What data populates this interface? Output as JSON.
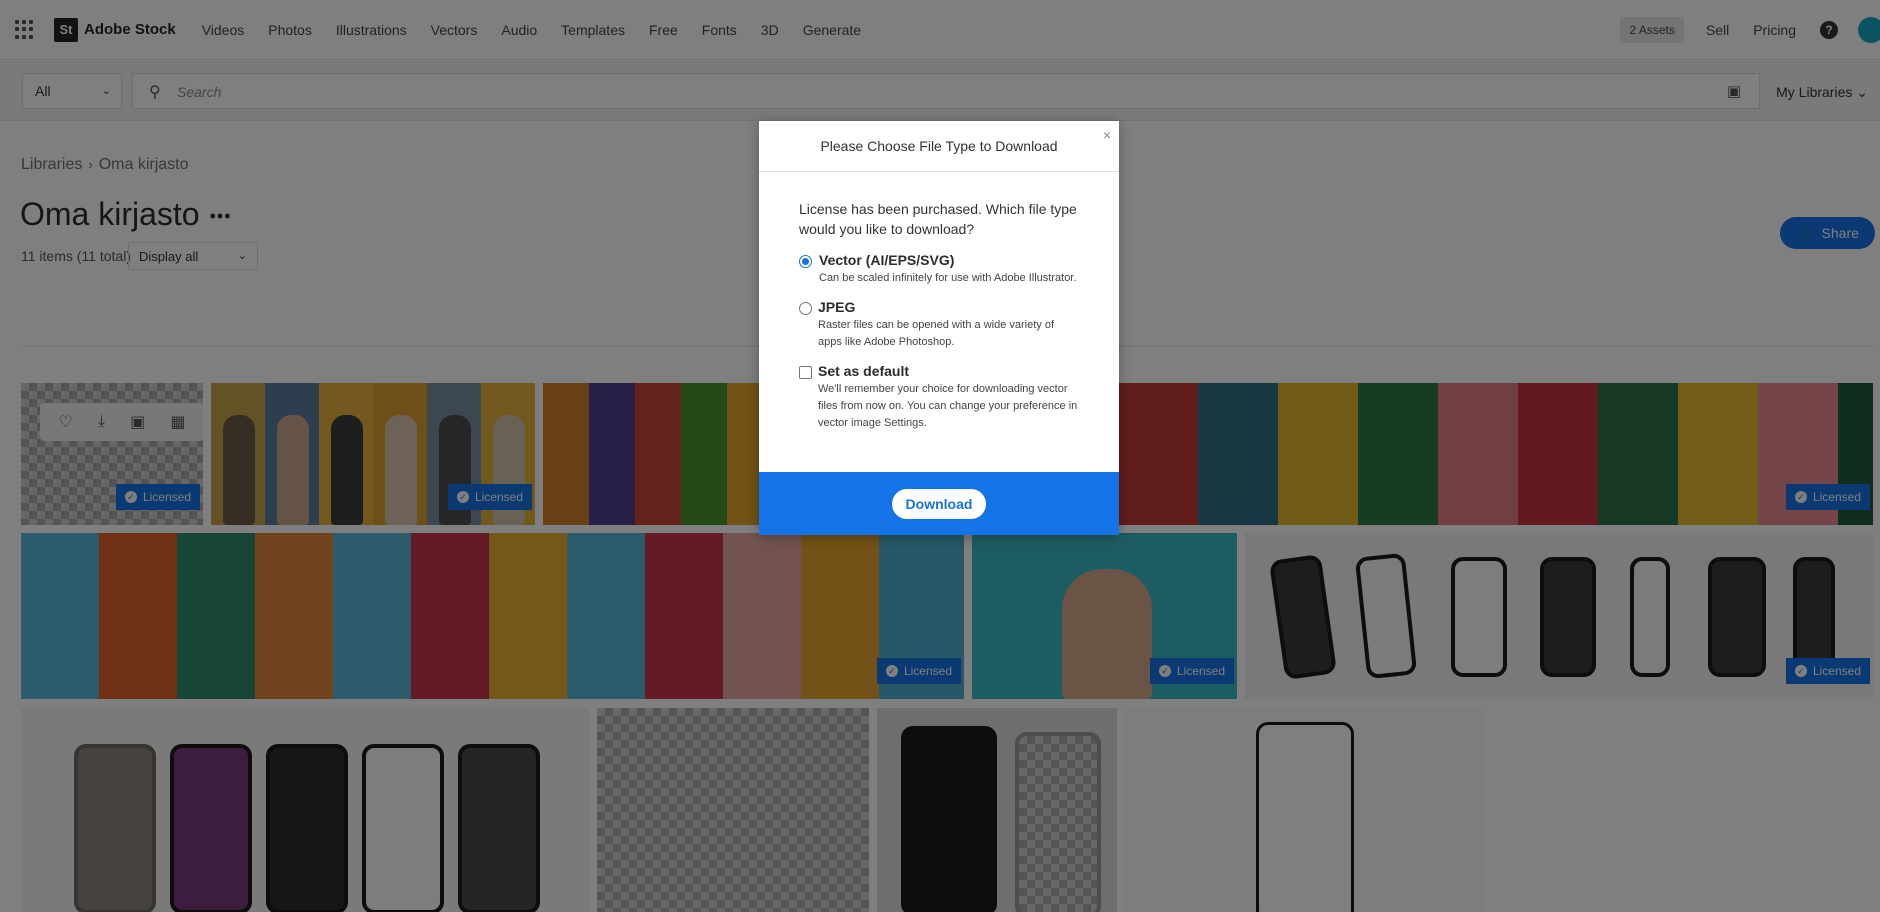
{
  "nav": {
    "brand_abbr": "St",
    "brand": "Adobe Stock",
    "links": [
      "Videos",
      "Photos",
      "Illustrations",
      "Vectors",
      "Audio",
      "Templates",
      "Free",
      "Fonts",
      "3D",
      "Generate"
    ],
    "assets": "2 Assets",
    "sell": "Sell",
    "pricing": "Pricing",
    "help": "?"
  },
  "search": {
    "category": "All",
    "placeholder": "Search",
    "my_libraries": "My Libraries"
  },
  "library": {
    "breadcrumb_root": "Libraries",
    "breadcrumb_current": "Oma kirjasto",
    "title": "Oma kirjasto",
    "more": "•••",
    "count": "11 items (11 total)",
    "display_filter": "Display all",
    "share": "Share"
  },
  "badge": {
    "licensed": "Licensed"
  },
  "modal": {
    "title": "Please Choose File Type to Download",
    "close": "×",
    "question": "License has been purchased. Which file type would you like to download?",
    "options": [
      {
        "title": "Vector (AI/EPS/SVG)",
        "desc": "Can be scaled infinitely for use with Adobe Illustrator.",
        "selected": true
      },
      {
        "title": "JPEG",
        "desc": "Raster files can be opened with a wide variety of apps like Adobe Photoshop.",
        "selected": false
      }
    ],
    "default": {
      "title": "Set as default",
      "desc": "We'll remember your choice for downloading vector files from now on. You can change your preference in vector image Settings.",
      "checked": false
    },
    "download": "Download"
  },
  "colors": {
    "accent": "#1473e6",
    "overlay": "rgba(0,0,0,0.5)"
  }
}
